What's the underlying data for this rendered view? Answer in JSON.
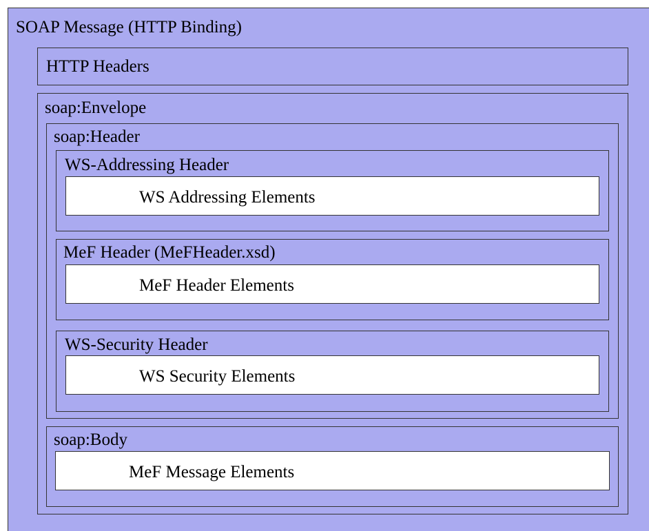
{
  "diagram": {
    "title": "SOAP Message (HTTP Binding)",
    "http_headers": "HTTP Headers",
    "envelope": {
      "label": "soap:Envelope",
      "header": {
        "label": "soap:Header",
        "ws_addressing": {
          "label": "WS-Addressing Header",
          "elements": "WS Addressing Elements"
        },
        "mef_header": {
          "label": "MeF Header (MeFHeader.xsd)",
          "elements": "MeF Header Elements"
        },
        "ws_security": {
          "label": "WS-Security Header",
          "elements": "WS Security Elements"
        }
      },
      "body": {
        "label": "soap:Body",
        "elements": "MeF Message Elements"
      }
    },
    "colors": {
      "container_fill": "#aaaaf0",
      "element_fill": "#ffffff",
      "border": "#333333"
    }
  }
}
